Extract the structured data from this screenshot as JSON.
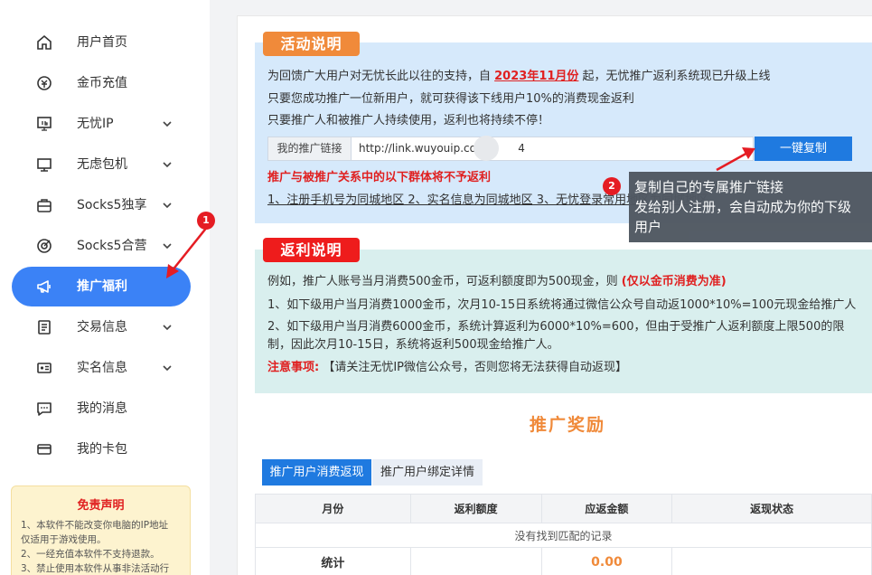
{
  "sidebar": {
    "items": [
      {
        "label": "用户首页",
        "icon": "home-icon",
        "chevron": false
      },
      {
        "label": "金币充值",
        "icon": "coin-recharge-icon",
        "chevron": false
      },
      {
        "label": "无忧IP",
        "icon": "ip-monitor-icon",
        "chevron": true
      },
      {
        "label": "无虑包机",
        "icon": "desktop-icon",
        "chevron": true
      },
      {
        "label": "Socks5独享",
        "icon": "briefcase-icon",
        "chevron": true
      },
      {
        "label": "Socks5合营",
        "icon": "target-icon",
        "chevron": true
      },
      {
        "label": "推广福利",
        "icon": "megaphone-icon",
        "chevron": false,
        "active": true
      },
      {
        "label": "交易信息",
        "icon": "document-icon",
        "chevron": true
      },
      {
        "label": "实名信息",
        "icon": "id-card-icon",
        "chevron": true
      },
      {
        "label": "我的消息",
        "icon": "message-icon",
        "chevron": false
      },
      {
        "label": "我的卡包",
        "icon": "card-icon",
        "chevron": false
      }
    ],
    "badge1": "1",
    "disclaimer": {
      "title": "免责声明",
      "lines": [
        "1、本软件不能改变你电脑的IP地址",
        "仅适用于游戏使用。",
        "2、一经充值本软件不支持退款。",
        "3、禁止使用本软件从事非法活动行"
      ]
    }
  },
  "activity": {
    "tag": "活动说明",
    "line1_pre": "为回馈广大用户对无忧长此以往的支持，自 ",
    "line1_highlight": "2023年11月份",
    "line1_post": " 起，无忧推广返利系统现已升级上线",
    "line2": "只要您成功推广一位新用户，就可获得该下线用户10%的消费现金返利",
    "line3": "只要推广人和被推广人持续使用，返利也将持续不停！",
    "link_label": "我的推广链接",
    "link_value": "http://link.wuyouip.com/        4",
    "copy_button": "一键复制",
    "warn_title": "推广与被推广关系中的以下群体将不予返利",
    "warn_items": "1、注册手机号为同城地区 2、实名信息为同城地区 3、无忧登录常用地区为同城地区"
  },
  "tooltip": {
    "badge": "2",
    "line1": "复制自己的专属推广链接",
    "line2": "发给别人注册，会自动成为你的下级",
    "line3": "用户"
  },
  "rebate": {
    "tag": "返利说明",
    "example_pre": "例如，推广人账号当月消费500金币，可返利额度即为500现金，则 ",
    "example_note": "(仅以金币消费为准)",
    "rule1": "1、如下级用户当月消费1000金币，次月10-15日系统将通过微信公众号自动返1000*10%=100元现金给推广人",
    "rule2a": "2、如下级用户当月消费6000金币，系统计算返利为6000*10%=600，但由于受推广人返利额度上限500的限",
    "rule2b": "制，因此次月10-15日，系统将返利500现金给推广人。",
    "notice_label": "注意事项:",
    "notice_text": " 【请关注无忧IP微信公众号，否则您将无法获得自动返现】"
  },
  "reward": {
    "title": "推广奖励",
    "tabs": [
      "推广用户消费返现",
      "推广用户绑定详情"
    ],
    "columns": [
      "月份",
      "返利额度",
      "应返金额",
      "返现状态"
    ],
    "empty_text": "没有找到匹配的记录",
    "total_label": "统计",
    "total_value": "0.00"
  },
  "colors": {
    "accent": "#3b82f6",
    "orange": "#f08a3a",
    "red": "#e02020",
    "button": "#1f7ae0"
  }
}
